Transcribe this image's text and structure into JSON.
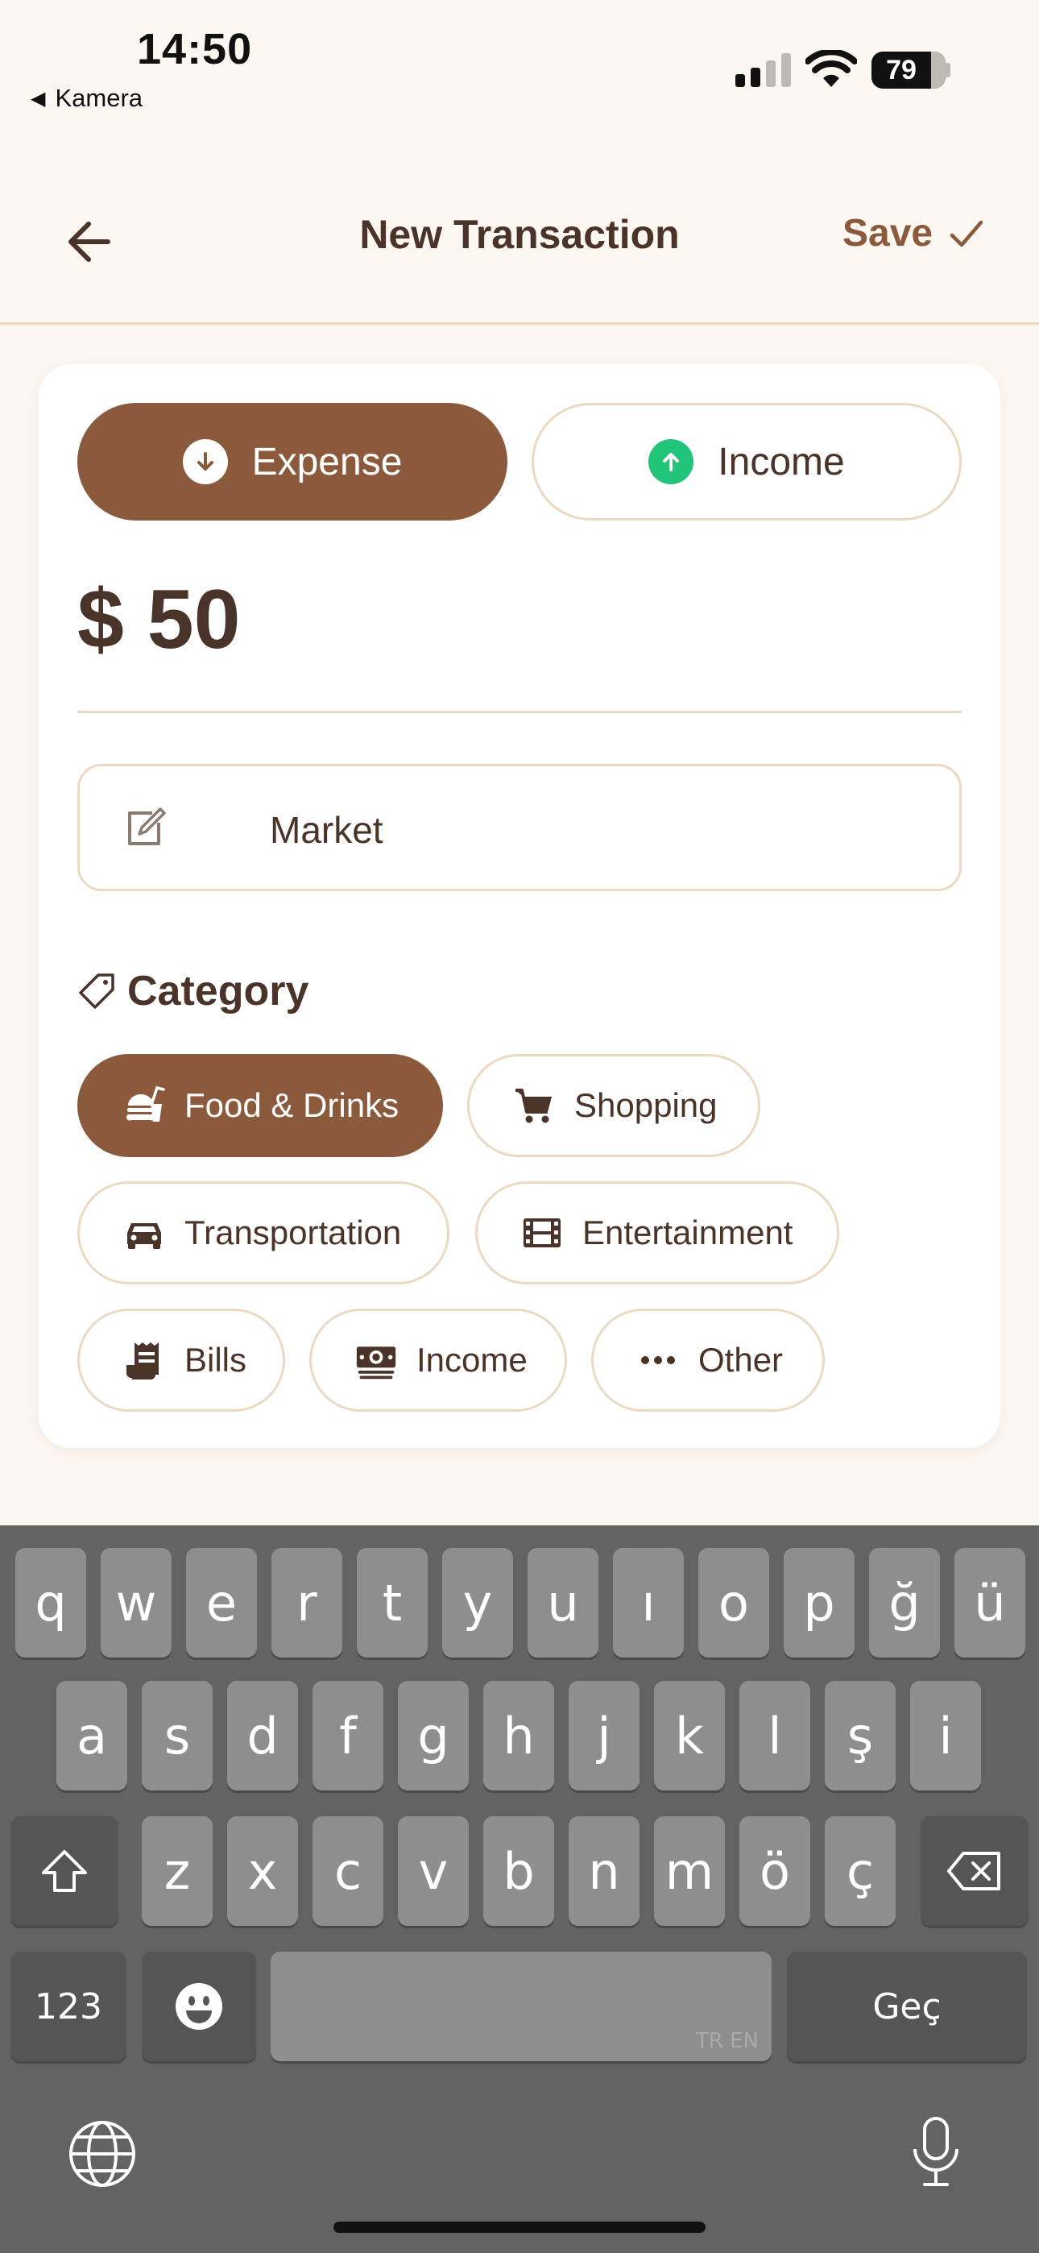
{
  "status_bar": {
    "time": "14:50",
    "back_app": "Kamera",
    "battery": "79"
  },
  "header": {
    "title": "New Transaction",
    "save_label": "Save",
    "back_icon": "arrow-left-icon",
    "save_icon": "check-icon"
  },
  "type_toggle": {
    "expense_label": "Expense",
    "income_label": "Income",
    "selected": "Expense"
  },
  "amount": {
    "currency": "$",
    "value": "50"
  },
  "note": {
    "value": "Market",
    "icon": "edit-icon"
  },
  "category": {
    "title": "Category",
    "icon": "tag-icon",
    "selected": "Food & Drinks",
    "items": [
      {
        "label": "Food & Drinks",
        "icon": "food-icon"
      },
      {
        "label": "Shopping",
        "icon": "cart-icon"
      },
      {
        "label": "Transportation",
        "icon": "car-icon"
      },
      {
        "label": "Entertainment",
        "icon": "film-icon"
      },
      {
        "label": "Bills",
        "icon": "receipt-icon"
      },
      {
        "label": "Income",
        "icon": "money-icon"
      },
      {
        "label": "Other",
        "icon": "more-icon"
      }
    ]
  },
  "keyboard": {
    "row1": [
      "q",
      "w",
      "e",
      "r",
      "t",
      "y",
      "u",
      "ı",
      "o",
      "p",
      "ğ",
      "ü"
    ],
    "row2": [
      "a",
      "s",
      "d",
      "f",
      "g",
      "h",
      "j",
      "k",
      "l",
      "ş",
      "i"
    ],
    "row3": [
      "z",
      "x",
      "c",
      "v",
      "b",
      "n",
      "m",
      "ö",
      "ç"
    ],
    "numbers_key": "123",
    "space_sub": "TR EN",
    "return_key": "Geç"
  },
  "colors": {
    "accent": "#8B5A3C",
    "text": "#4A3328",
    "income_green": "#22C47A",
    "background": "#FDF7F2",
    "border": "#EBD9C2"
  }
}
